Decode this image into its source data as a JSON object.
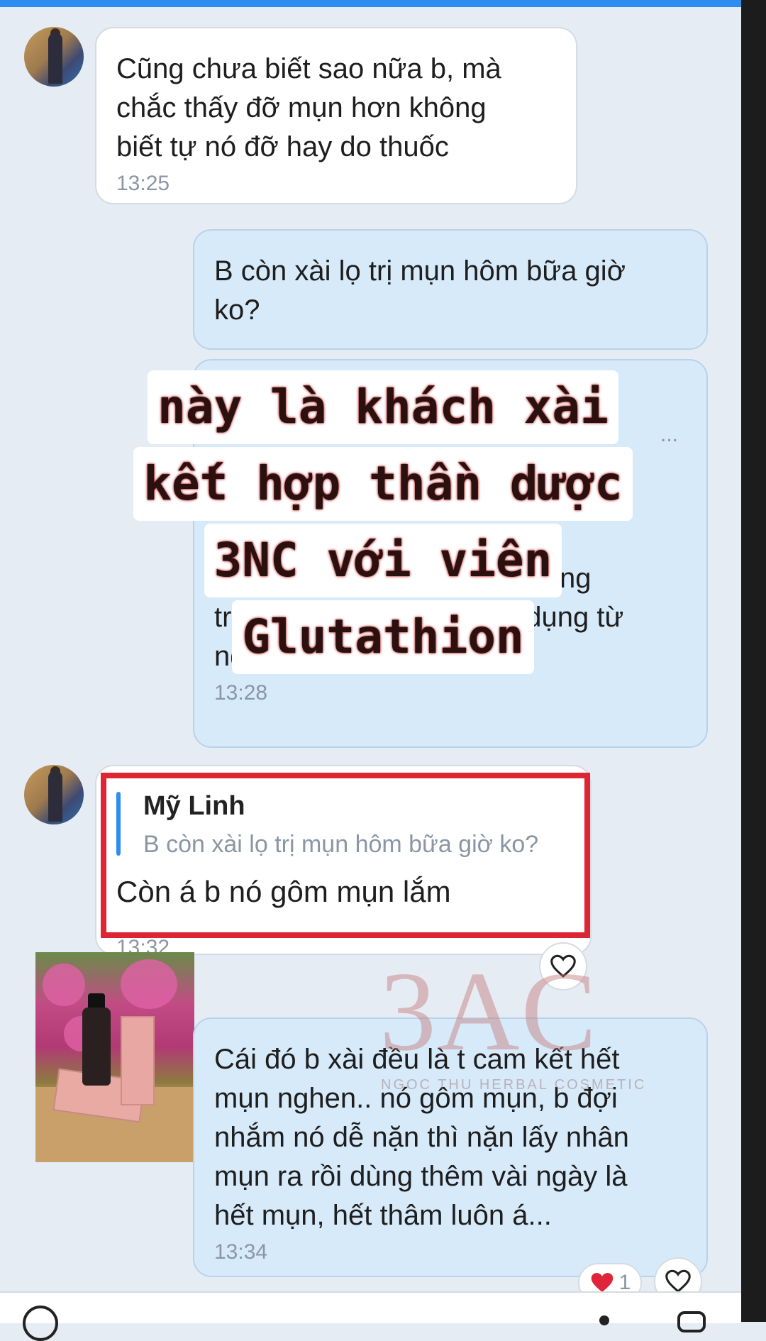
{
  "messages": [
    {
      "sender": "incoming",
      "text": "Cũng chưa biết sao nữa b, mà\nchắc thấy đỡ mụn hơn không\nbiết tự nó đỡ hay do thuốc",
      "time": "13:25"
    },
    {
      "sender": "outgoing",
      "text": "B còn xài lọ trị mụn hôm bữa giờ\nko?"
    },
    {
      "sender": "outgoing",
      "text_partial": "...",
      "text": "uống là nó tác dụng bên trong\ntrước. Mỹ phẩm mới tác dụng từ\nngoài vào á",
      "time": "13:28"
    },
    {
      "sender": "incoming",
      "quote": {
        "name": "Mỹ Linh",
        "text": "B còn xài lọ trị mụn hôm bữa giờ ko?"
      },
      "text": "Còn á b nó gôm mụn lắm",
      "time": "13:32"
    },
    {
      "sender": "outgoing",
      "text": "Cái đó b xài đều là t cam kết hết\nmụn nghen.. nó gôm mụn, b đợi\nnhắm nó dễ nặn thì nặn lấy nhân\nmụn ra rồi dùng thêm vài ngày là\nhết mụn, hết thâm luôn á...",
      "time": "13:34",
      "reaction_count": "1"
    }
  ],
  "overlay_caption": [
    "này là khách xài",
    "kết hợp thần dược",
    "3NC với viên",
    "Glutathion"
  ],
  "watermark": {
    "logo": "3AC",
    "tagline": "NGOC THU HERBAL COSMETIC"
  },
  "icons": {
    "heart_outline": "heart-outline-icon",
    "heart_filled": "heart-filled-icon"
  },
  "colors": {
    "accent": "#2f8df0",
    "highlight_border": "#de2533",
    "outgoing_bubble": "#d7eafa",
    "incoming_bubble": "#ffffff",
    "reaction_heart": "#e0243a"
  }
}
